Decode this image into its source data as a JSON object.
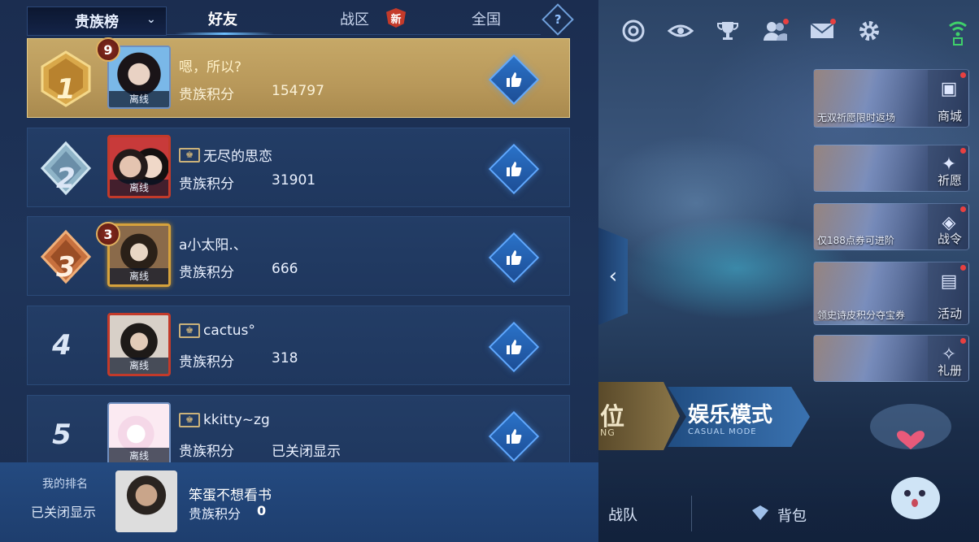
{
  "header": {
    "dropdown_label": "贵族榜",
    "tabs": [
      {
        "label": "好友",
        "active": true
      },
      {
        "label": "战区",
        "badge": "新"
      },
      {
        "label": "全国"
      }
    ],
    "help_icon": "question-diamond-icon"
  },
  "rows": [
    {
      "rank": "1",
      "level": "9",
      "name": "嗯，所以?",
      "score_label": "贵族积分",
      "score": "154797",
      "status": "离线",
      "vip": false
    },
    {
      "rank": "2",
      "level": "",
      "name": "无尽的思恋",
      "score_label": "贵族积分",
      "score": "31901",
      "status": "离线",
      "vip": true
    },
    {
      "rank": "3",
      "level": "3",
      "name": "a小太阳.、",
      "score_label": "贵族积分",
      "score": "666",
      "status": "离线",
      "vip": false
    },
    {
      "rank": "4",
      "level": "",
      "name": "cactus°",
      "score_label": "贵族积分",
      "score": "318",
      "status": "离线",
      "vip": true
    },
    {
      "rank": "5",
      "level": "",
      "name": "kkitty~zg",
      "score_label": "贵族积分",
      "score": "已关闭显示",
      "status": "离线",
      "vip": true
    }
  ],
  "my_rank": {
    "label": "我的排名",
    "rank": "已关闭显示",
    "name": "笨蛋不想看书",
    "score_label": "贵族积分",
    "score": "0"
  },
  "side_menu": [
    {
      "caption": "无双祈愿限时返场",
      "label": "商城"
    },
    {
      "caption": "",
      "label": "祈愿"
    },
    {
      "caption": "仅188点券可进阶",
      "label": "战令"
    },
    {
      "caption": "领史诗皮积分夺宝券",
      "label": "活动"
    },
    {
      "caption": "",
      "label": "礼册"
    }
  ],
  "modes": {
    "ranked_label": "位",
    "ranked_sub": "NG",
    "casual_label": "娱乐模式",
    "casual_sub": "CASUAL MODE"
  },
  "bottom_nav": {
    "team_label": "战队",
    "bag_label": "背包"
  },
  "colors": {
    "panel_bg": "#1e3459",
    "gold_row": "#c6a867",
    "like_button": "#2a72c8",
    "badge_red": "#c43a2a"
  }
}
